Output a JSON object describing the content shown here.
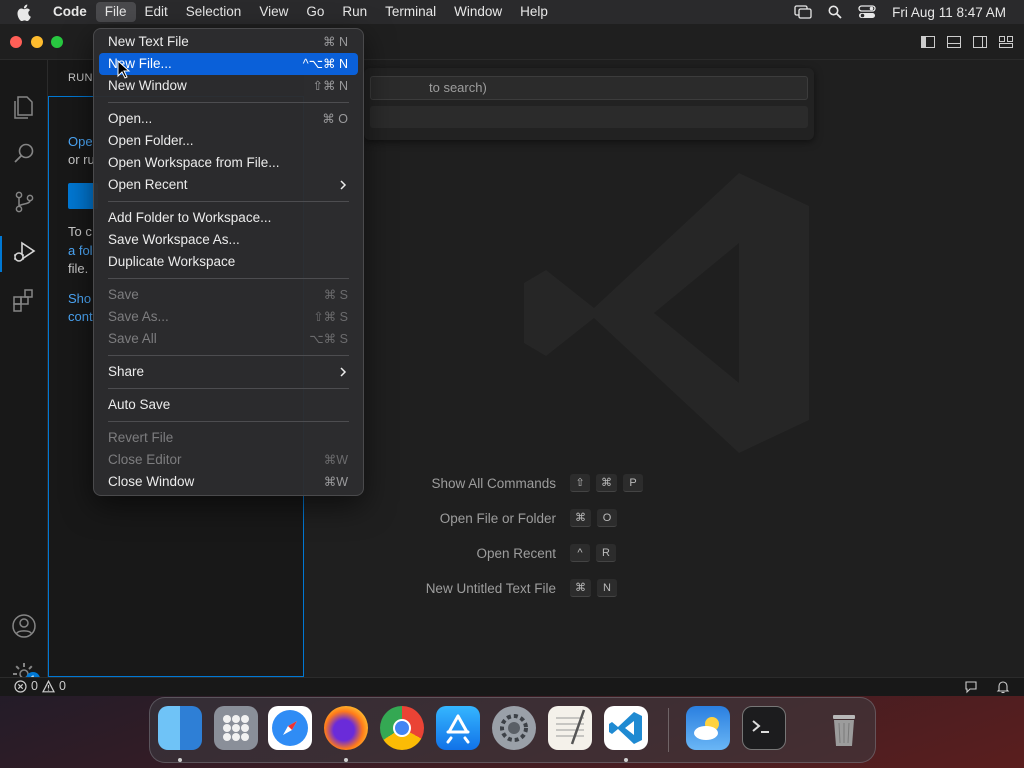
{
  "menubar": {
    "app_name": "Code",
    "items": [
      "File",
      "Edit",
      "Selection",
      "View",
      "Go",
      "Run",
      "Terminal",
      "Window",
      "Help"
    ],
    "active_item": "File",
    "clock": "Fri Aug 11  8:47 AM"
  },
  "sidebar": {
    "title": "RUN",
    "line1a": "Ope",
    "line1b": "or ru",
    "line2a": "To c",
    "line2b": "a fol",
    "line2c": "file.",
    "line3a": "Sho",
    "line3b": "cont"
  },
  "command_center": {
    "placeholder_fragment": "to search)"
  },
  "welcome_shortcuts": [
    {
      "label": "Show All Commands",
      "keys": [
        "⇧",
        "⌘",
        "P"
      ]
    },
    {
      "label": "Open File or Folder",
      "keys": [
        "⌘",
        "O"
      ]
    },
    {
      "label": "Open Recent",
      "keys": [
        "^",
        "R"
      ]
    },
    {
      "label": "New Untitled Text File",
      "keys": [
        "⌘",
        "N"
      ]
    }
  ],
  "file_menu": {
    "groups": [
      [
        {
          "label": "New Text File",
          "shortcut": "⌘ N"
        },
        {
          "label": "New File...",
          "shortcut": "^⌥⌘ N",
          "highlighted": true
        },
        {
          "label": "New Window",
          "shortcut": "⇧⌘ N"
        }
      ],
      [
        {
          "label": "Open...",
          "shortcut": "⌘ O"
        },
        {
          "label": "Open Folder...",
          "shortcut": ""
        },
        {
          "label": "Open Workspace from File...",
          "shortcut": ""
        },
        {
          "label": "Open Recent",
          "shortcut": "",
          "submenu": true
        }
      ],
      [
        {
          "label": "Add Folder to Workspace...",
          "shortcut": ""
        },
        {
          "label": "Save Workspace As...",
          "shortcut": ""
        },
        {
          "label": "Duplicate Workspace",
          "shortcut": ""
        }
      ],
      [
        {
          "label": "Save",
          "shortcut": "⌘ S",
          "disabled": true
        },
        {
          "label": "Save As...",
          "shortcut": "⇧⌘ S",
          "disabled": true
        },
        {
          "label": "Save All",
          "shortcut": "⌥⌘ S",
          "disabled": true
        }
      ],
      [
        {
          "label": "Share",
          "shortcut": "",
          "submenu": true
        }
      ],
      [
        {
          "label": "Auto Save",
          "shortcut": ""
        }
      ],
      [
        {
          "label": "Revert File",
          "shortcut": "",
          "disabled": true
        },
        {
          "label": "Close Editor",
          "shortcut": "⌘W",
          "disabled": true
        },
        {
          "label": "Close Window",
          "shortcut": "⌘W"
        }
      ]
    ]
  },
  "statusbar": {
    "errors": "0",
    "warnings": "0"
  },
  "activity_bar": {
    "badge": "1",
    "icons": [
      "explorer-icon",
      "search-icon",
      "source-control-icon",
      "run-debug-icon",
      "extensions-icon",
      "accounts-icon",
      "manage-gear-icon"
    ]
  },
  "dock": {
    "apps": [
      "finder",
      "launchpad",
      "safari",
      "firefox",
      "chrome",
      "app-store",
      "system-settings",
      "textedit",
      "vscode",
      "weather",
      "terminal",
      "trash"
    ]
  },
  "colors": {
    "accent": "#0078d4",
    "menu_highlight": "#0a60d9",
    "link": "#4daafc"
  }
}
